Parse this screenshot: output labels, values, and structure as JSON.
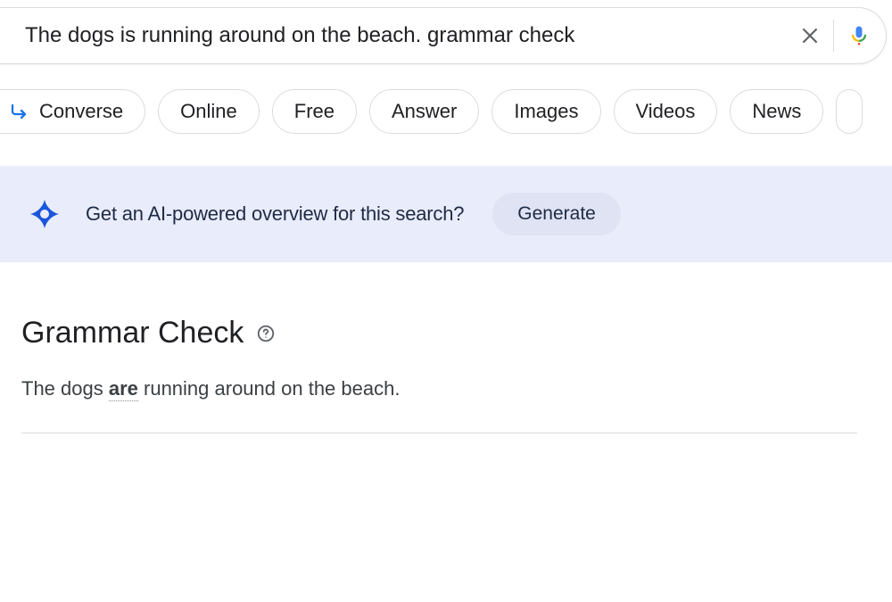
{
  "search": {
    "value": "The dogs is running around on the beach. grammar check"
  },
  "chips": [
    "Converse",
    "Online",
    "Free",
    "Answer",
    "Images",
    "Videos",
    "News"
  ],
  "ai_banner": {
    "text": "Get an AI-powered overview for this search?",
    "generate_label": "Generate"
  },
  "result": {
    "title": "Grammar Check",
    "sentence_prefix": "The dogs ",
    "corrected_word": "are",
    "sentence_suffix": " running around on the beach."
  }
}
